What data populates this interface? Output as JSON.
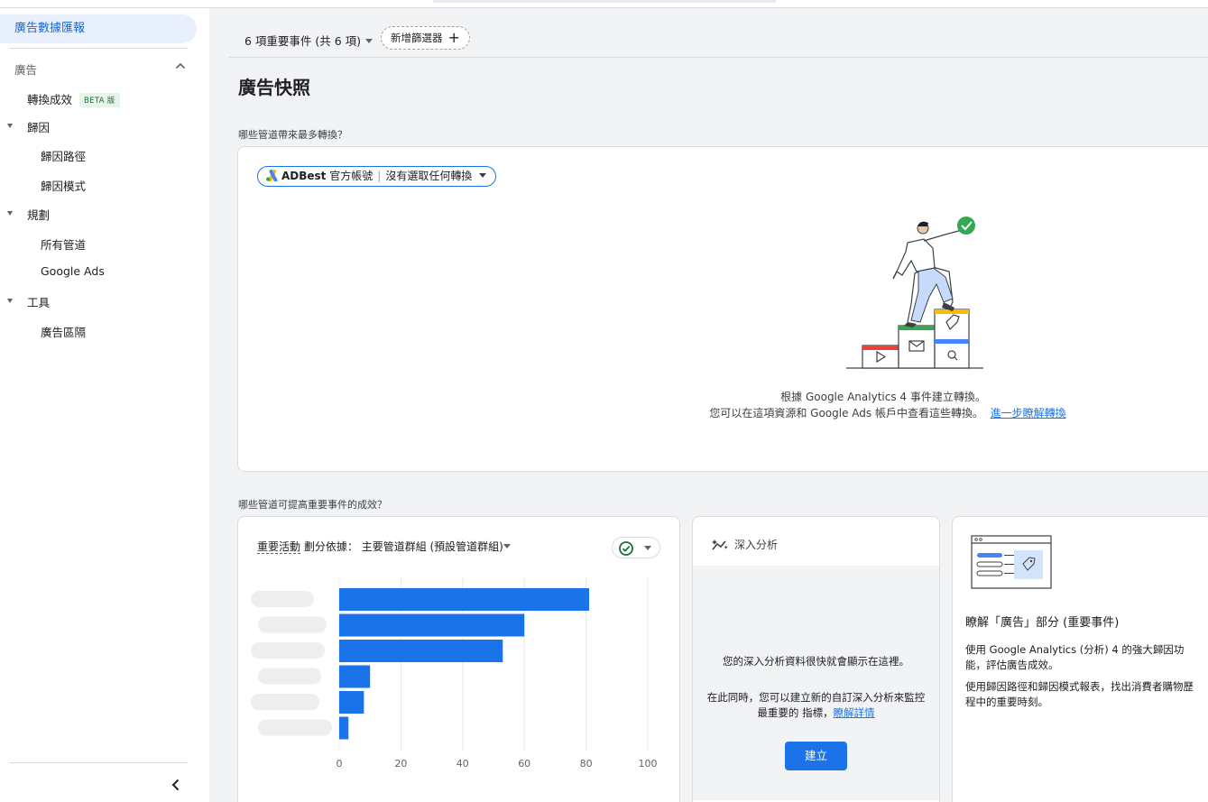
{
  "sidebar": {
    "active": "廣告數據匯報",
    "section": "廣告",
    "items": [
      {
        "label": "轉換成效",
        "badge": "BETA 版"
      },
      {
        "label": "歸因"
      },
      {
        "label": "歸因路徑"
      },
      {
        "label": "歸因模式"
      },
      {
        "label": "規劃"
      },
      {
        "label": "所有管道"
      },
      {
        "label": "Google Ads"
      },
      {
        "label": "工具"
      },
      {
        "label": "廣告區隔"
      }
    ],
    "icons": {
      "section_toggle": "chevron-up-icon",
      "expand": "caret-down-icon",
      "collapse": "chevron-left-icon"
    }
  },
  "filter": {
    "events_label": "6 項重要事件 (共 6 項)",
    "add_filter_label": "新增篩選器"
  },
  "page": {
    "title": "廣告快照",
    "question1": "哪些管道帶來最多轉換？",
    "question2": "哪些管道可提高重要事件的成效？"
  },
  "snapshot": {
    "account_name": "ADBest",
    "account_label": "官方帳號",
    "conversion_label": "沒有選取任何轉換",
    "empty_line1": "根據 Google Analytics 4 事件建立轉換。",
    "empty_line2": "您可以在這項資源和 Google Ads 帳戶中查看這些轉換。",
    "empty_link": "進一步瞭解轉換"
  },
  "channel_chart": {
    "metric_label": "重要活動",
    "dimension_prefix": "劃分依據：",
    "dimension_label": "主要管道群組 (預設管道群組)"
  },
  "chart_data": {
    "type": "bar",
    "orientation": "horizontal",
    "categories": [
      "",
      "",
      "",
      "",
      "",
      ""
    ],
    "values": [
      81,
      60,
      53,
      10,
      8,
      3
    ],
    "xlim": [
      0,
      100
    ],
    "xticks": [
      "0",
      "20",
      "40",
      "60",
      "80",
      "100"
    ],
    "bar_color": "#1a73e8",
    "grid": "vertical"
  },
  "insights": {
    "title": "深入分析",
    "line1": "您的深入分析資料很快就會顯示在這裡。",
    "line2": "在此同時，您可以建立新的自訂深入分析來監控最重要的 指標，",
    "link": "瞭解詳情",
    "button": "建立"
  },
  "learn": {
    "title": "瞭解「廣告」部分 (重要事件)",
    "p1": "使用 Google Analytics (分析) 4 的強大歸因功能，評估廣告成效。",
    "p2": "使用歸因路徑和歸因模式報表，找出消費者購物歷程中的重要時刻。"
  },
  "colors": {
    "accent": "#1a73e8",
    "active_bg": "#e8f0fe",
    "beta_bg": "#e6f4ea",
    "beta_text": "#137333"
  }
}
